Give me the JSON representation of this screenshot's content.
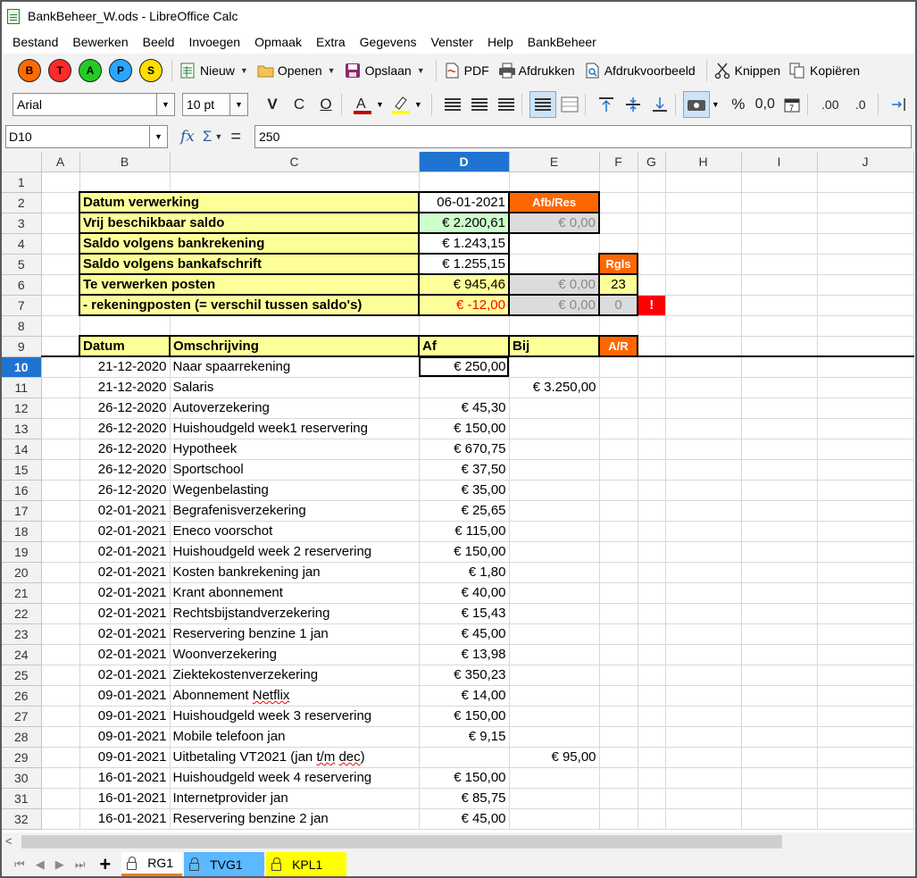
{
  "window": {
    "title": "BankBeheer_W.ods - LibreOffice Calc"
  },
  "menu": [
    "Bestand",
    "Bewerken",
    "Beeld",
    "Invoegen",
    "Opmaak",
    "Extra",
    "Gegevens",
    "Venster",
    "Help",
    "BankBeheer"
  ],
  "toolbar": {
    "circle_buttons": [
      {
        "label": "B",
        "color": "#ff6a00"
      },
      {
        "label": "T",
        "color": "#ff2a2a"
      },
      {
        "label": "A",
        "color": "#22cc22"
      },
      {
        "label": "P",
        "color": "#2aa6ff"
      },
      {
        "label": "S",
        "color": "#ffdd00"
      }
    ],
    "new_label": "Nieuw",
    "open_label": "Openen",
    "save_label": "Opslaan",
    "pdf_label": "PDF",
    "print_label": "Afdrukken",
    "preview_label": "Afdrukvoorbeeld",
    "cut_label": "Knippen",
    "copy_label": "Kopiëren"
  },
  "format": {
    "font_name": "Arial",
    "font_size": "10 pt",
    "bold": "V",
    "italic": "C",
    "underline": "O",
    "percent": "%",
    "number": "0,0",
    "decimal_add": ".00",
    "decimal_remove": ".0"
  },
  "formula": {
    "cell_ref": "D10",
    "fx": "fx",
    "sum": "Σ",
    "equals": "=",
    "value": "250"
  },
  "columns": [
    "A",
    "B",
    "C",
    "D",
    "E",
    "F",
    "G",
    "H",
    "I",
    "J"
  ],
  "summary": {
    "r2": {
      "label": "Datum verwerking",
      "d": "06-01-2021",
      "e": "Afb/Res"
    },
    "r3": {
      "label": "Vrij beschikbaar saldo",
      "d": "€ 2.200,61",
      "e": "€ 0,00"
    },
    "r4": {
      "label": "Saldo volgens bankrekening",
      "d": "€ 1.243,15"
    },
    "r5": {
      "label": "Saldo volgens bankafschrift",
      "d": "€ 1.255,15",
      "f": "Rgls"
    },
    "r6": {
      "label": "Te verwerken posten",
      "d": "€ 945,46",
      "e": "€ 0,00",
      "f": "23"
    },
    "r7": {
      "label": "- rekeningposten (= verschil tussen saldo's)",
      "d": "€ -12,00",
      "e": "€ 0,00",
      "f": "0",
      "g": "!"
    }
  },
  "table": {
    "headers": {
      "datum": "Datum",
      "omschrijving": "Omschrijving",
      "af": "Af",
      "bij": "Bij",
      "ar": "A/R"
    },
    "rows": [
      {
        "row": "10",
        "datum": "21-12-2020",
        "omschrijving": "Naar spaarrekening",
        "af": "€ 250,00",
        "bij": ""
      },
      {
        "row": "11",
        "datum": "21-12-2020",
        "omschrijving": "Salaris",
        "af": "",
        "bij": "€ 3.250,00"
      },
      {
        "row": "12",
        "datum": "26-12-2020",
        "omschrijving": "Autoverzekering",
        "af": "€ 45,30",
        "bij": ""
      },
      {
        "row": "13",
        "datum": "26-12-2020",
        "omschrijving": "Huishoudgeld week1 reservering",
        "af": "€ 150,00",
        "bij": ""
      },
      {
        "row": "14",
        "datum": "26-12-2020",
        "omschrijving": "Hypotheek",
        "af": "€ 670,75",
        "bij": ""
      },
      {
        "row": "15",
        "datum": "26-12-2020",
        "omschrijving": "Sportschool",
        "af": "€ 37,50",
        "bij": ""
      },
      {
        "row": "16",
        "datum": "26-12-2020",
        "omschrijving": "Wegenbelasting",
        "af": "€ 35,00",
        "bij": ""
      },
      {
        "row": "17",
        "datum": "02-01-2021",
        "omschrijving": "Begrafenisverzekering",
        "af": "€ 25,65",
        "bij": ""
      },
      {
        "row": "18",
        "datum": "02-01-2021",
        "omschrijving": "Eneco voorschot",
        "af": "€ 115,00",
        "bij": ""
      },
      {
        "row": "19",
        "datum": "02-01-2021",
        "omschrijving": "Huishoudgeld week 2 reservering",
        "af": "€ 150,00",
        "bij": ""
      },
      {
        "row": "20",
        "datum": "02-01-2021",
        "omschrijving": "Kosten bankrekening jan",
        "af": "€ 1,80",
        "bij": ""
      },
      {
        "row": "21",
        "datum": "02-01-2021",
        "omschrijving": "Krant abonnement",
        "af": "€ 40,00",
        "bij": ""
      },
      {
        "row": "22",
        "datum": "02-01-2021",
        "omschrijving": "Rechtsbijstandverzekering",
        "af": "€ 15,43",
        "bij": ""
      },
      {
        "row": "23",
        "datum": "02-01-2021",
        "omschrijving": "Reservering benzine 1 jan",
        "af": "€ 45,00",
        "bij": ""
      },
      {
        "row": "24",
        "datum": "02-01-2021",
        "omschrijving": "Woonverzekering",
        "af": "€ 13,98",
        "bij": ""
      },
      {
        "row": "25",
        "datum": "02-01-2021",
        "omschrijving": "Ziektekostenverzekering",
        "af": "€ 350,23",
        "bij": ""
      },
      {
        "row": "26",
        "datum": "09-01-2021",
        "omschrijving": "Abonnement Netflix",
        "af": "€ 14,00",
        "bij": ""
      },
      {
        "row": "27",
        "datum": "09-01-2021",
        "omschrijving": "Huishoudgeld week 3 reservering",
        "af": "€ 150,00",
        "bij": ""
      },
      {
        "row": "28",
        "datum": "09-01-2021",
        "omschrijving": "Mobile telefoon  jan",
        "af": "€ 9,15",
        "bij": ""
      },
      {
        "row": "29",
        "datum": "09-01-2021",
        "omschrijving": "Uitbetaling VT2021 (jan t/m dec)",
        "af": "",
        "bij": "€ 95,00"
      },
      {
        "row": "30",
        "datum": "16-01-2021",
        "omschrijving": "Huishoudgeld week 4 reservering",
        "af": "€ 150,00",
        "bij": ""
      },
      {
        "row": "31",
        "datum": "16-01-2021",
        "omschrijving": "Internetprovider jan",
        "af": "€ 85,75",
        "bij": ""
      },
      {
        "row": "32",
        "datum": "16-01-2021",
        "omschrijving": "Reservering benzine 2 jan",
        "af": "€ 45,00",
        "bij": ""
      }
    ]
  },
  "sheets": [
    {
      "name": "RG1",
      "color": "#ffffff",
      "active": true
    },
    {
      "name": "TVG1",
      "color": "#5cb8ff",
      "active": false
    },
    {
      "name": "KPL1",
      "color": "#ffff00",
      "active": false
    }
  ]
}
